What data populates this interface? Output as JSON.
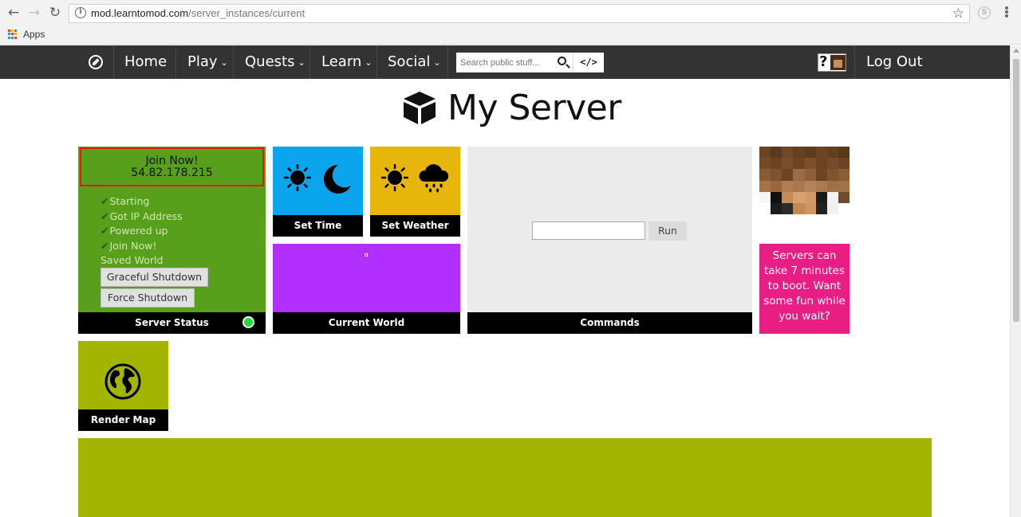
{
  "browser": {
    "url_host": "mod.learntomod.com",
    "url_path": "/server_instances/current",
    "bookmarks": {
      "apps_label": "Apps"
    }
  },
  "nav": {
    "items": [
      {
        "label": "Home"
      },
      {
        "label": "Play",
        "dropdown": true
      },
      {
        "label": "Quests",
        "dropdown": true
      },
      {
        "label": "Learn",
        "dropdown": true
      },
      {
        "label": "Social",
        "dropdown": true
      }
    ],
    "caret": "⌄",
    "search_placeholder": "Search public stuff...",
    "code_label": "</>",
    "logout_label": "Log Out",
    "avatar_mark": "?"
  },
  "page": {
    "title": "My Server"
  },
  "server_status": {
    "join_line1": "Join Now!",
    "join_ip": "54.82.178.215",
    "steps": [
      "Starting",
      "Got IP Address",
      "Powered up",
      "Join Now!"
    ],
    "saved_world": "Saved World",
    "graceful_shutdown": "Graceful Shutdown",
    "force_shutdown": "Force Shutdown",
    "caption": "Server Status",
    "status_color": "#1fdc37"
  },
  "tiles": {
    "set_time": {
      "caption": "Set Time",
      "color": "#0aa5ed"
    },
    "set_weather": {
      "caption": "Set Weather",
      "color": "#e6b60a"
    },
    "current_world": {
      "caption": "Current World",
      "color": "#b22fff"
    },
    "commands": {
      "caption": "Commands",
      "run_label": "Run",
      "input_value": ""
    },
    "promo": {
      "text": "Servers can take 7 minutes to boot. Want some fun while you wait?",
      "color": "#e91e84"
    },
    "render_map": {
      "caption": "Render Map",
      "color": "#a4b500"
    }
  },
  "skin_colors": [
    "#6b4422",
    "#5a3a1c",
    "#714826",
    "#66401f",
    "#5e3b1d",
    "#6e4524",
    "#63401f",
    "#5a391b",
    "#744a27",
    "#6a4423",
    "#7a4e2a",
    "#6d4523",
    "#7c502b",
    "#694322",
    "#774b28",
    "#6c4424",
    "#8a5a33",
    "#7e5330",
    "#6c4324",
    "#9b6b44",
    "#8e603a",
    "#6d4425",
    "#7f5431",
    "#8c5c35",
    "#a57347",
    "#986940",
    "#b07d52",
    "#a8774c",
    "#b5825a",
    "#a97a4e",
    "#9f6f45",
    "#a2724a",
    "#f6f6f6",
    "#111111",
    "#c48a58",
    "#d9a06c",
    "#d29a66",
    "#1a1a1a",
    "#f2f2f2",
    "#6f4a2b",
    "#ffffff",
    "#1c1c1c",
    "#2a2a2a",
    "#c08955",
    "#cf9663",
    "#222222",
    "#f0f0f0",
    "#ffffff"
  ]
}
